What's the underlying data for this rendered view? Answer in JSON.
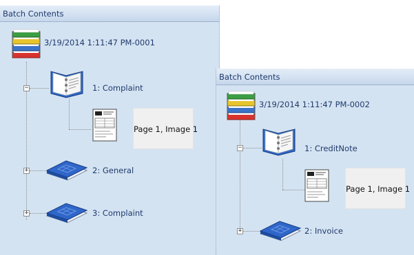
{
  "panel1": {
    "header": "Batch Contents",
    "batch_label": "3/19/2014 1:11:47 PM-0001",
    "folders": [
      {
        "label": "1: Complaint",
        "state": "expanded",
        "icon": "open-binder-icon",
        "pages": [
          {
            "label": "Page 1, Image 1",
            "icon": "document-page-icon"
          }
        ]
      },
      {
        "label": "2: General",
        "state": "collapsed",
        "icon": "closed-book-icon"
      },
      {
        "label": "3: Complaint",
        "state": "collapsed",
        "icon": "closed-book-icon"
      }
    ]
  },
  "panel2": {
    "header": "Batch Contents",
    "batch_label": "3/19/2014 1:11:47 PM-0002",
    "folders": [
      {
        "label": "1: CreditNote",
        "state": "expanded",
        "icon": "open-binder-icon",
        "pages": [
          {
            "label": "Page 1, Image 1",
            "icon": "document-page-icon"
          }
        ]
      },
      {
        "label": "2: Invoice",
        "state": "collapsed",
        "icon": "closed-book-icon"
      }
    ]
  },
  "icons": {
    "batch": "batch-trays-icon",
    "expand": "plus-expander-icon",
    "collapse": "minus-expander-icon"
  },
  "colors": {
    "panel_bg": "#d4e3f2",
    "header_bg": "#c6d7ec",
    "text": "#1f3a6b",
    "thumb_bg": "#f0f0f0",
    "book_blue": "#2f66c9"
  }
}
